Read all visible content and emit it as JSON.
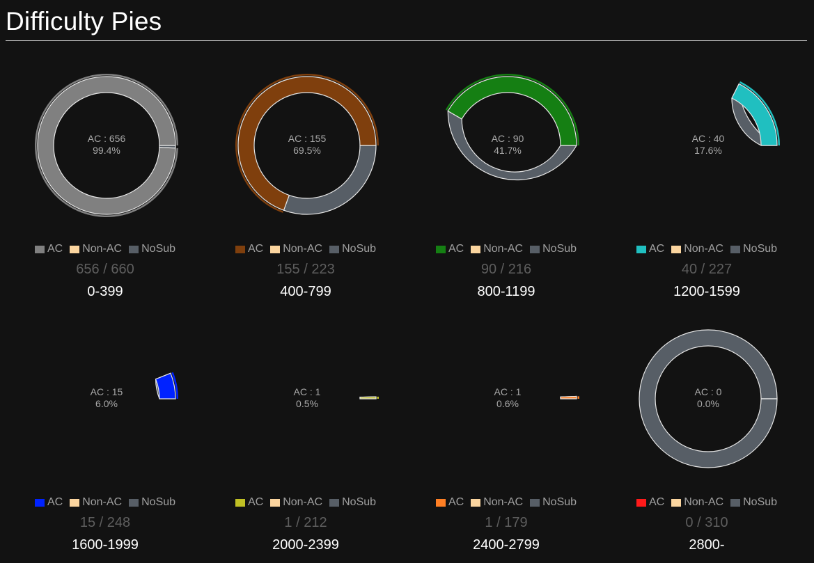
{
  "page": {
    "title": "Difficulty Pies"
  },
  "colors": {
    "nonac": "#fbd59f",
    "nosub": "#575e66",
    "stroke": "#e6e6e6",
    "background": "#121212"
  },
  "legend_labels": {
    "ac": "AC",
    "nonac": "Non-AC",
    "nosub": "NoSub"
  },
  "chart_data": [
    {
      "type": "pie",
      "range": "0-399",
      "ac": 656,
      "nonac": 0,
      "total": 660,
      "ac_label": "AC : 656",
      "pct_label": "99.4%",
      "count_label": "656 / 660",
      "ac_color": "#808080",
      "slices": [
        "AC",
        "Non-AC",
        "NoSub"
      ]
    },
    {
      "type": "pie",
      "range": "400-799",
      "ac": 155,
      "nonac": 0,
      "total": 223,
      "ac_label": "AC : 155",
      "pct_label": "69.5%",
      "count_label": "155 / 223",
      "ac_color": "#7f3f0d",
      "slices": [
        "AC",
        "Non-AC",
        "NoSub"
      ]
    },
    {
      "type": "pie",
      "range": "800-1199",
      "ac": 90,
      "nonac": 0,
      "total": 216,
      "ac_label": "AC : 90",
      "pct_label": "41.7%",
      "count_label": "90 / 216",
      "ac_color": "#157f13",
      "slices": [
        "AC",
        "Non-AC",
        "NoSub"
      ]
    },
    {
      "type": "pie",
      "range": "1200-1599",
      "ac": 40,
      "nonac": 0,
      "total": 227,
      "ac_label": "AC : 40",
      "pct_label": "17.6%",
      "count_label": "40 / 227",
      "ac_color": "#20bfc0",
      "slices": [
        "AC",
        "Non-AC",
        "NoSub"
      ]
    },
    {
      "type": "pie",
      "range": "1600-1999",
      "ac": 15,
      "nonac": 0,
      "total": 248,
      "ac_label": "AC : 15",
      "pct_label": "6.0%",
      "count_label": "15 / 248",
      "ac_color": "#0022ff",
      "slices": [
        "AC",
        "Non-AC",
        "NoSub"
      ]
    },
    {
      "type": "pie",
      "range": "2000-2399",
      "ac": 1,
      "nonac": 0,
      "total": 212,
      "ac_label": "AC : 1",
      "pct_label": "0.5%",
      "count_label": "1 / 212",
      "ac_color": "#c0c024",
      "slices": [
        "AC",
        "Non-AC",
        "NoSub"
      ]
    },
    {
      "type": "pie",
      "range": "2400-2799",
      "ac": 1,
      "nonac": 0,
      "total": 179,
      "ac_label": "AC : 1",
      "pct_label": "0.6%",
      "count_label": "1 / 179",
      "ac_color": "#ff7f24",
      "slices": [
        "AC",
        "Non-AC",
        "NoSub"
      ]
    },
    {
      "type": "pie",
      "range": "2800-",
      "ac": 0,
      "nonac": 0,
      "total": 310,
      "ac_label": "AC : 0",
      "pct_label": "0.0%",
      "count_label": "0 / 310",
      "ac_color": "#ff1a1a",
      "slices": [
        "AC",
        "Non-AC",
        "NoSub"
      ]
    }
  ]
}
